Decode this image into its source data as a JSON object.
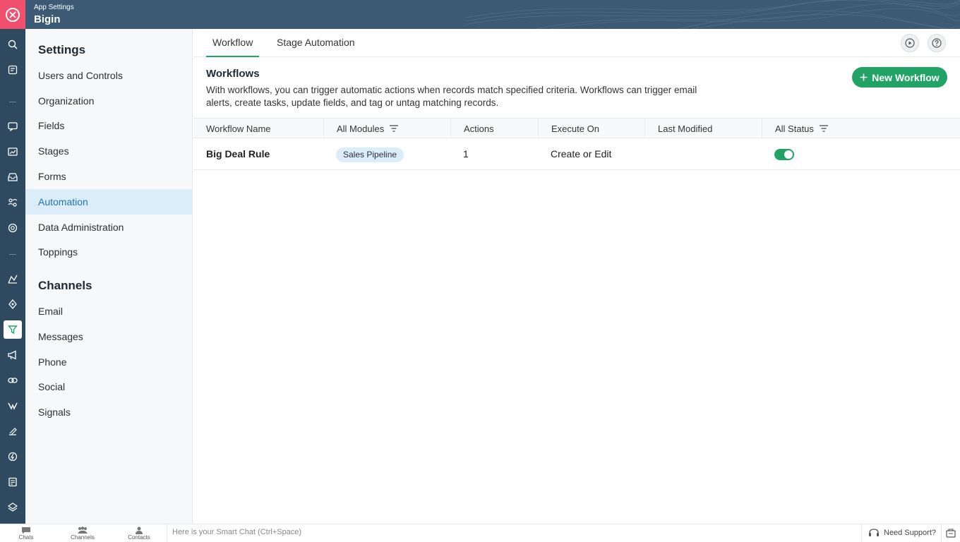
{
  "header": {
    "subtitle": "App Settings",
    "title": "Bigin"
  },
  "sidebar": {
    "settings_heading": "Settings",
    "settings_items": [
      {
        "label": "Users and Controls"
      },
      {
        "label": "Organization"
      },
      {
        "label": "Fields"
      },
      {
        "label": "Stages"
      },
      {
        "label": "Forms"
      },
      {
        "label": "Automation",
        "active": true
      },
      {
        "label": "Data Administration"
      },
      {
        "label": "Toppings"
      }
    ],
    "channels_heading": "Channels",
    "channels_items": [
      {
        "label": "Email"
      },
      {
        "label": "Messages"
      },
      {
        "label": "Phone"
      },
      {
        "label": "Social"
      },
      {
        "label": "Signals"
      }
    ]
  },
  "tabs": [
    {
      "label": "Workflow",
      "active": true
    },
    {
      "label": "Stage Automation"
    }
  ],
  "section": {
    "title": "Workflows",
    "description": "With workflows, you can trigger automatic actions when records match specified criteria. Workflows can trigger email alerts, create tasks, update fields, and tag or untag matching records.",
    "new_button": "New Workflow"
  },
  "table": {
    "columns": [
      "Workflow Name",
      "All Modules",
      "Actions",
      "Execute On",
      "Last Modified",
      "All Status"
    ],
    "rows": [
      {
        "name": "Big Deal Rule",
        "module": "Sales Pipeline",
        "actions": "1",
        "execute_on": "Create or Edit",
        "last_modified": "",
        "status_on": true
      }
    ]
  },
  "bottombar": {
    "chats": "Chats",
    "channels": "Channels",
    "contacts": "Contacts",
    "smart_chat_placeholder": "Here is your Smart Chat (Ctrl+Space)",
    "support": "Need Support?"
  },
  "colors": {
    "accent_green": "#21a366",
    "header_blue": "#3c5a73",
    "rail_blue": "#2f4a60",
    "close_red": "#f0506e",
    "active_blue": "#1f74b7"
  }
}
